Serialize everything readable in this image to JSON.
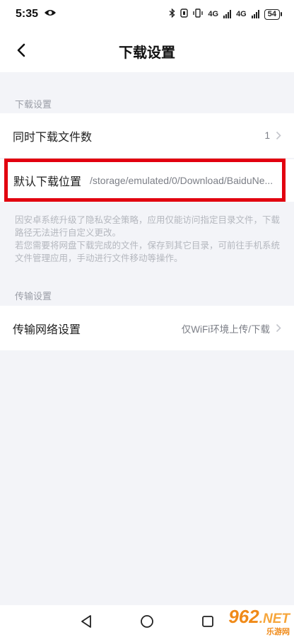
{
  "status_bar": {
    "time": "5:35",
    "net1": "4G",
    "net2": "4G",
    "battery": "54"
  },
  "header": {
    "title": "下载设置"
  },
  "sections": {
    "download_label": "下载设置",
    "transfer_label": "传输设置"
  },
  "rows": {
    "concurrent_label": "同时下载文件数",
    "concurrent_value": "1",
    "location_label": "默认下载位置",
    "location_value": "/storage/emulated/0/Download/BaiduNe...",
    "network_label": "传输网络设置",
    "network_value": "仅WiFi环境上传/下载"
  },
  "notice": {
    "line1": "因安卓系统升级了隐私安全策略，应用仅能访问指定目录文件，下载路径无法进行自定义更改。",
    "line2": "若您需要将网盘下载完成的文件，保存到其它目录，可前往手机系统文件管理应用，手动进行文件移动等操作。"
  },
  "watermark": {
    "main": "962",
    "suffix": ".NET",
    "sub": "乐游网"
  },
  "colors": {
    "highlight": "#e2000f",
    "background": "#f3f4f8",
    "watermark": "#f08a18"
  }
}
